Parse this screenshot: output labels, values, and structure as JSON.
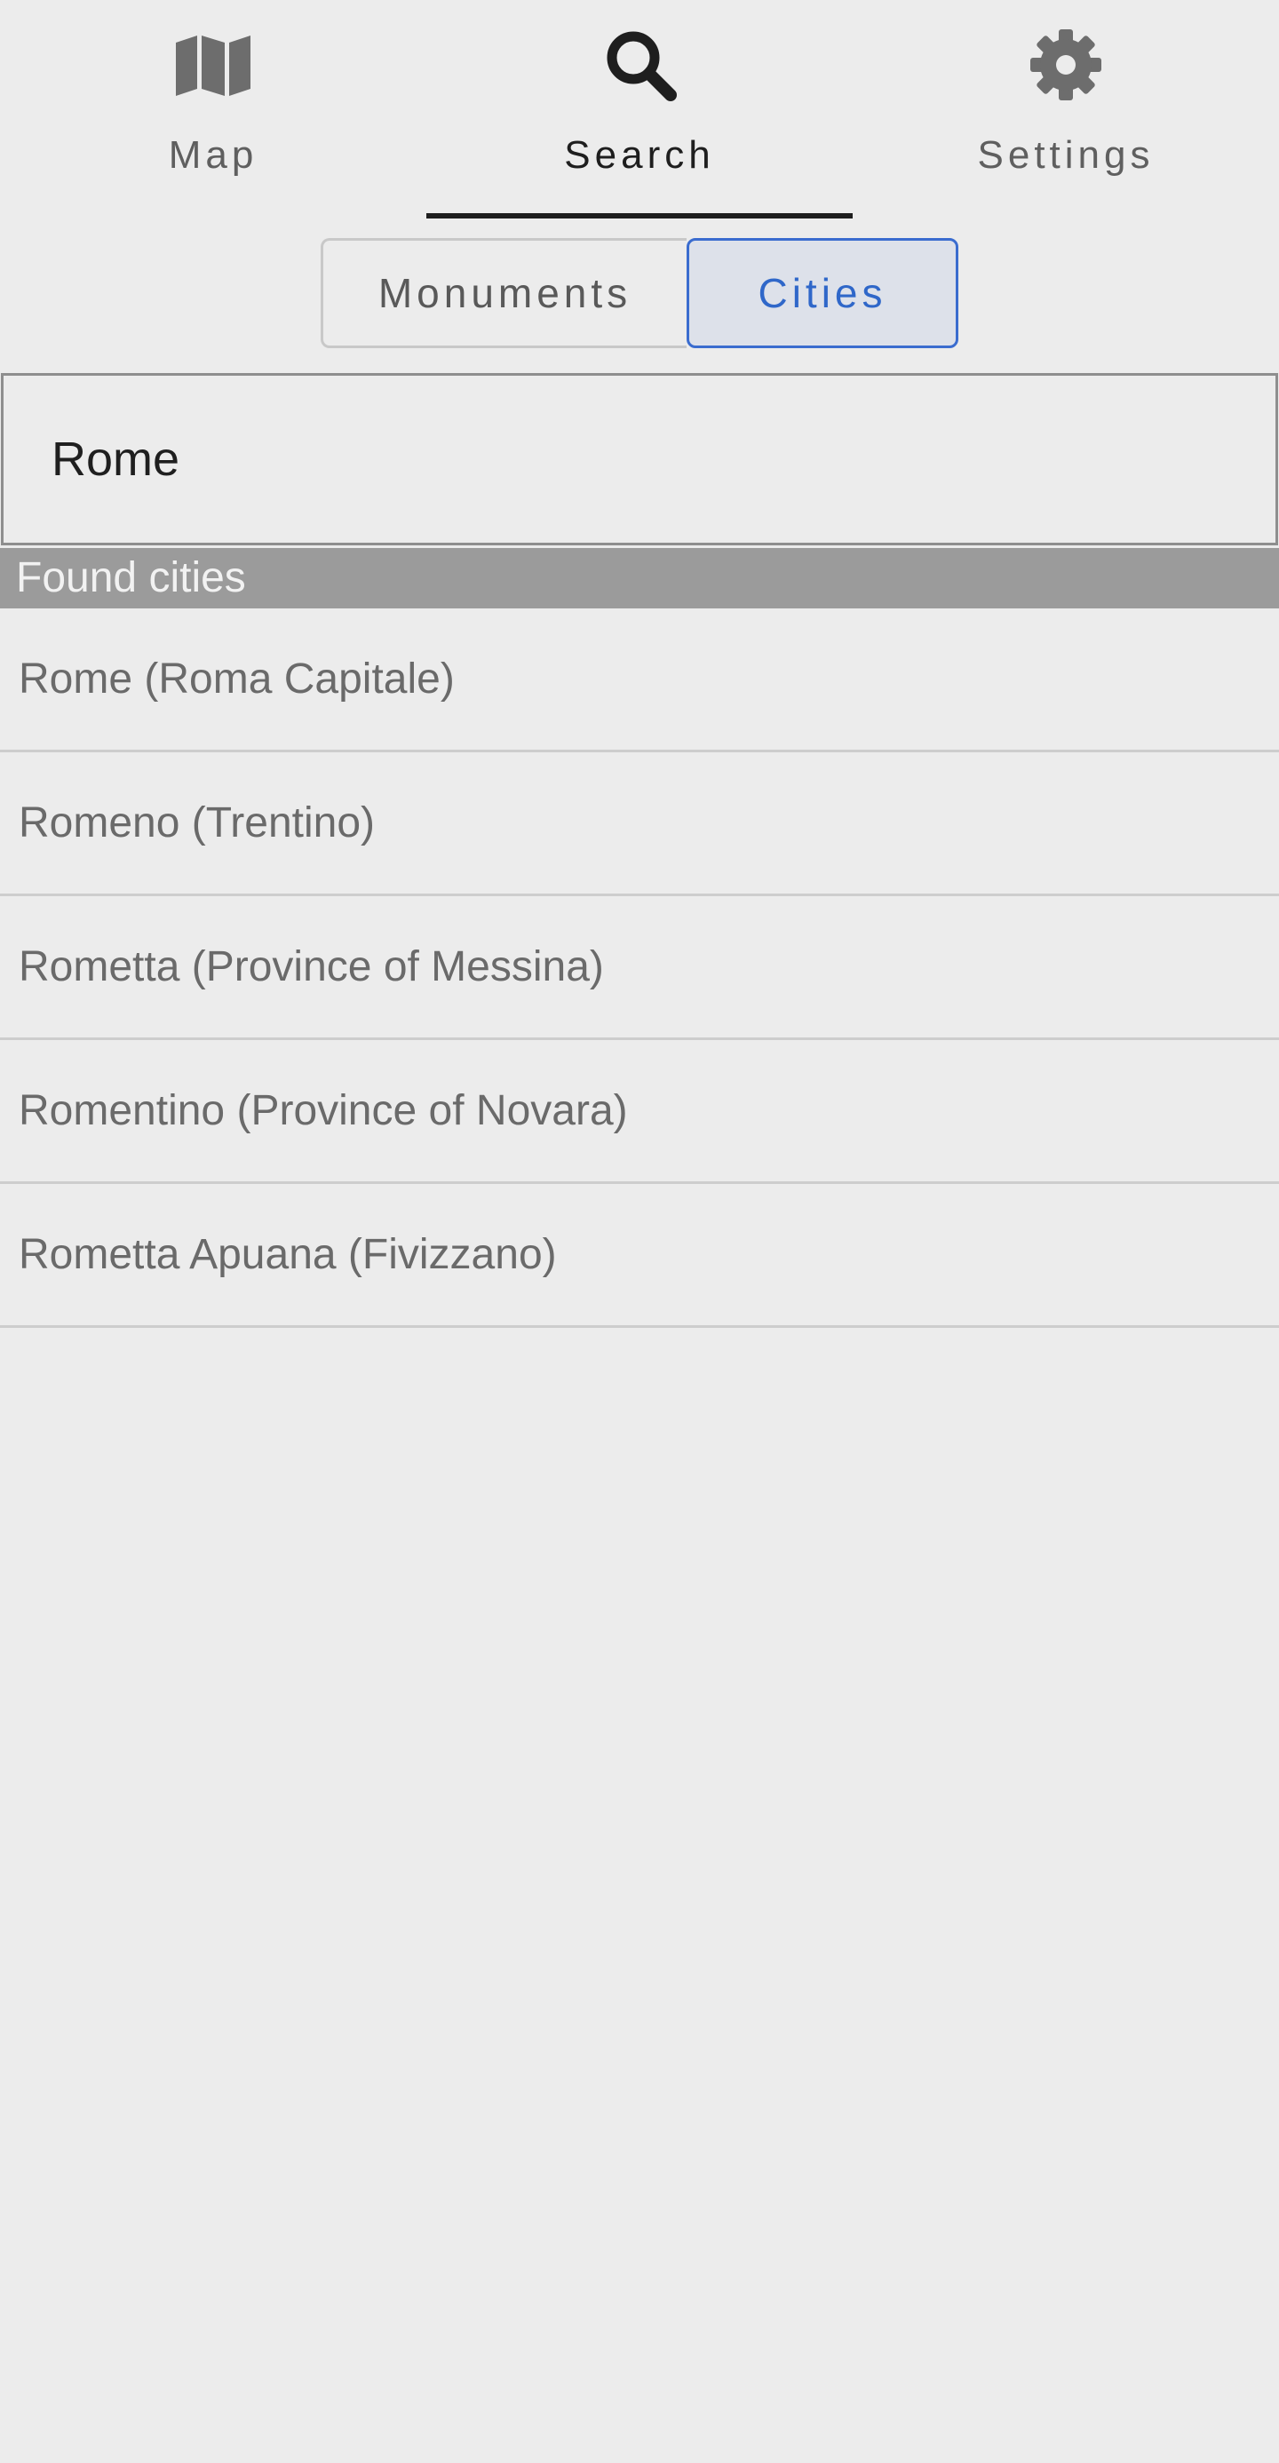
{
  "tabs": [
    {
      "label": "Map",
      "icon": "map-icon",
      "active": false
    },
    {
      "label": "Search",
      "icon": "search-icon",
      "active": true
    },
    {
      "label": "Settings",
      "icon": "gear-icon",
      "active": false
    }
  ],
  "segmented": {
    "monuments_label": "Monuments",
    "cities_label": "Cities",
    "selected": "Cities"
  },
  "search": {
    "value": "Rome"
  },
  "results": {
    "header": "Found cities",
    "items": [
      "Rome (Roma Capitale)",
      "Romeno (Trentino)",
      "Rometta (Province of Messina)",
      "Romentino (Province of Novara)",
      "Rometta Apuana (Fivizzano)"
    ]
  },
  "colors": {
    "background": "#ececec",
    "accent": "#3a6ccf",
    "header_bg": "#9b9b9b"
  }
}
